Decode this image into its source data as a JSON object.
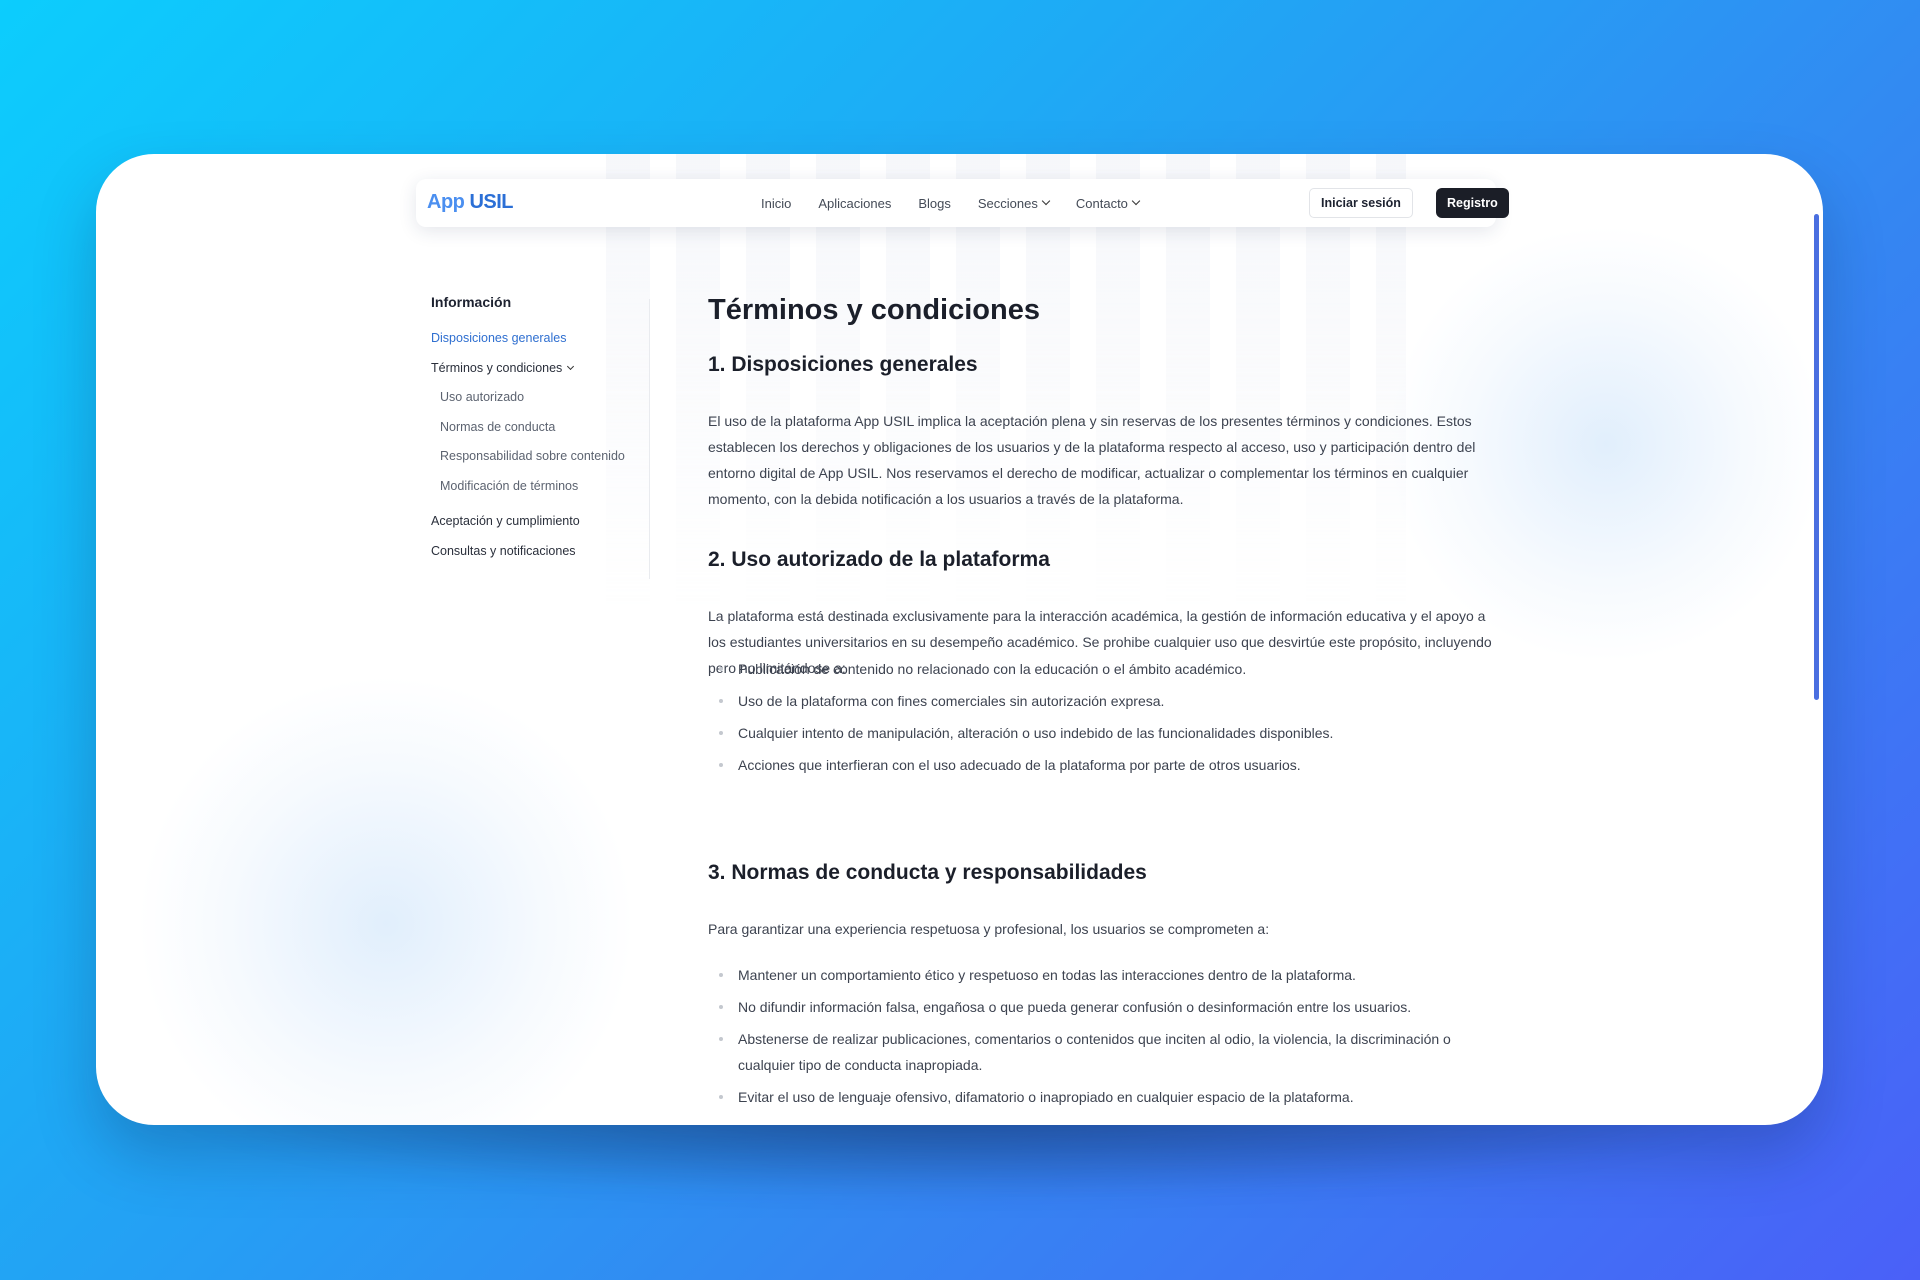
{
  "nav": {
    "logo_app": "App",
    "logo_usil": "USIL",
    "links": [
      "Inicio",
      "Aplicaciones",
      "Blogs",
      "Secciones",
      "Contacto"
    ],
    "login": "Iniciar sesión",
    "register": "Registro"
  },
  "sidebar": {
    "title": "Información",
    "items": [
      "Disposiciones generales",
      "Términos y condiciones",
      "Aceptación y cumplimiento",
      "Consultas y notificaciones"
    ],
    "subitems": [
      "Uso autorizado",
      "Normas de conducta",
      "Responsabilidad sobre contenido",
      "Modificación de términos"
    ]
  },
  "content": {
    "title": "Términos y condiciones",
    "sections": [
      {
        "heading": "1. Disposiciones generales",
        "paragraph": "El uso de la plataforma App USIL implica la aceptación plena y sin reservas de los presentes términos y condiciones. Estos establecen los derechos y obligaciones de los usuarios y de la plataforma respecto al acceso, uso y participación dentro del entorno digital de App USIL. Nos reservamos el derecho de modificar, actualizar o complementar los términos en cualquier momento, con la debida notificación a los usuarios a través de la plataforma."
      },
      {
        "heading": "2. Uso autorizado de la plataforma",
        "paragraph": "La plataforma está destinada exclusivamente para la interacción académica, la gestión de información educativa y el apoyo a los estudiantes universitarios en su desempeño académico. Se prohibe cualquier uso que desvirtúe este propósito, incluyendo pero no limitándose a:",
        "bullets": [
          "Publicación de contenido no relacionado con la educación o el ámbito académico.",
          "Uso de la plataforma con fines comerciales sin autorización expresa.",
          "Cualquier intento de manipulación, alteración o uso indebido de las funcionalidades disponibles.",
          "Acciones que interfieran con el uso adecuado de la plataforma por parte de otros usuarios."
        ]
      },
      {
        "heading": "3. Normas de conducta y responsabilidades",
        "paragraph": "Para garantizar una experiencia respetuosa y profesional, los usuarios se comprometen a:",
        "bullets": [
          "Mantener un comportamiento ético y respetuoso en todas las interacciones dentro de la plataforma.",
          "No difundir información falsa, engañosa o que pueda generar confusión o desinformación entre los usuarios.",
          "Abstenerse de realizar publicaciones, comentarios o contenidos que inciten al odio, la violencia, la discriminación o cualquier tipo de conducta inapropiada.",
          "Evitar el uso de lenguaje ofensivo, difamatorio o inapropiado en cualquier espacio de la plataforma."
        ]
      }
    ]
  },
  "colors": {
    "accent": "#2f6fd0",
    "dark_button": "#1b1e27",
    "background_start": "#0ccdfd",
    "background_end": "#4a60f8"
  }
}
